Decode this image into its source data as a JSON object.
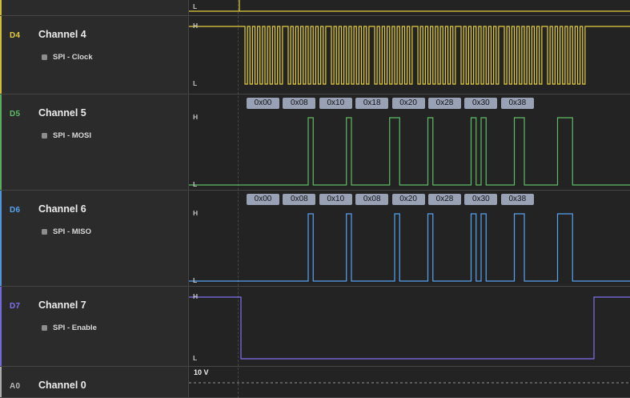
{
  "markers": {
    "high": "H",
    "low": "L"
  },
  "colors": {
    "annotation_bg": "#99a1b4",
    "annotation_text": "#15151c",
    "divider": "#454545",
    "sidebar_bg": "#2b2b2b",
    "wave_bg": "#232323"
  },
  "channels": [
    {
      "id": "",
      "name": "",
      "color": "#e3cd3f",
      "role": "partial-digital"
    },
    {
      "id": "D4",
      "name": "Channel 4",
      "analyzer": "SPI - Clock",
      "color": "#e3cd3f",
      "role": "clock"
    },
    {
      "id": "D5",
      "name": "Channel 5",
      "analyzer": "SPI - MOSI",
      "color": "#5fbc66",
      "role": "data",
      "bytes": [
        "0x00",
        "0x08",
        "0x10",
        "0x18",
        "0x20",
        "0x28",
        "0x30",
        "0x38"
      ]
    },
    {
      "id": "D6",
      "name": "Channel 6",
      "analyzer": "SPI - MISO",
      "color": "#56a3f2",
      "role": "data",
      "bytes": [
        "0x00",
        "0x08",
        "0x10",
        "0x08",
        "0x20",
        "0x28",
        "0x30",
        "0x38"
      ]
    },
    {
      "id": "D7",
      "name": "Channel 7",
      "analyzer": "SPI - Enable",
      "color": "#8070f2",
      "role": "enable"
    },
    {
      "id": "A0",
      "name": "Channel 0",
      "color": "#b9b9b9",
      "role": "analog",
      "scale_label": "10 V"
    }
  ]
}
